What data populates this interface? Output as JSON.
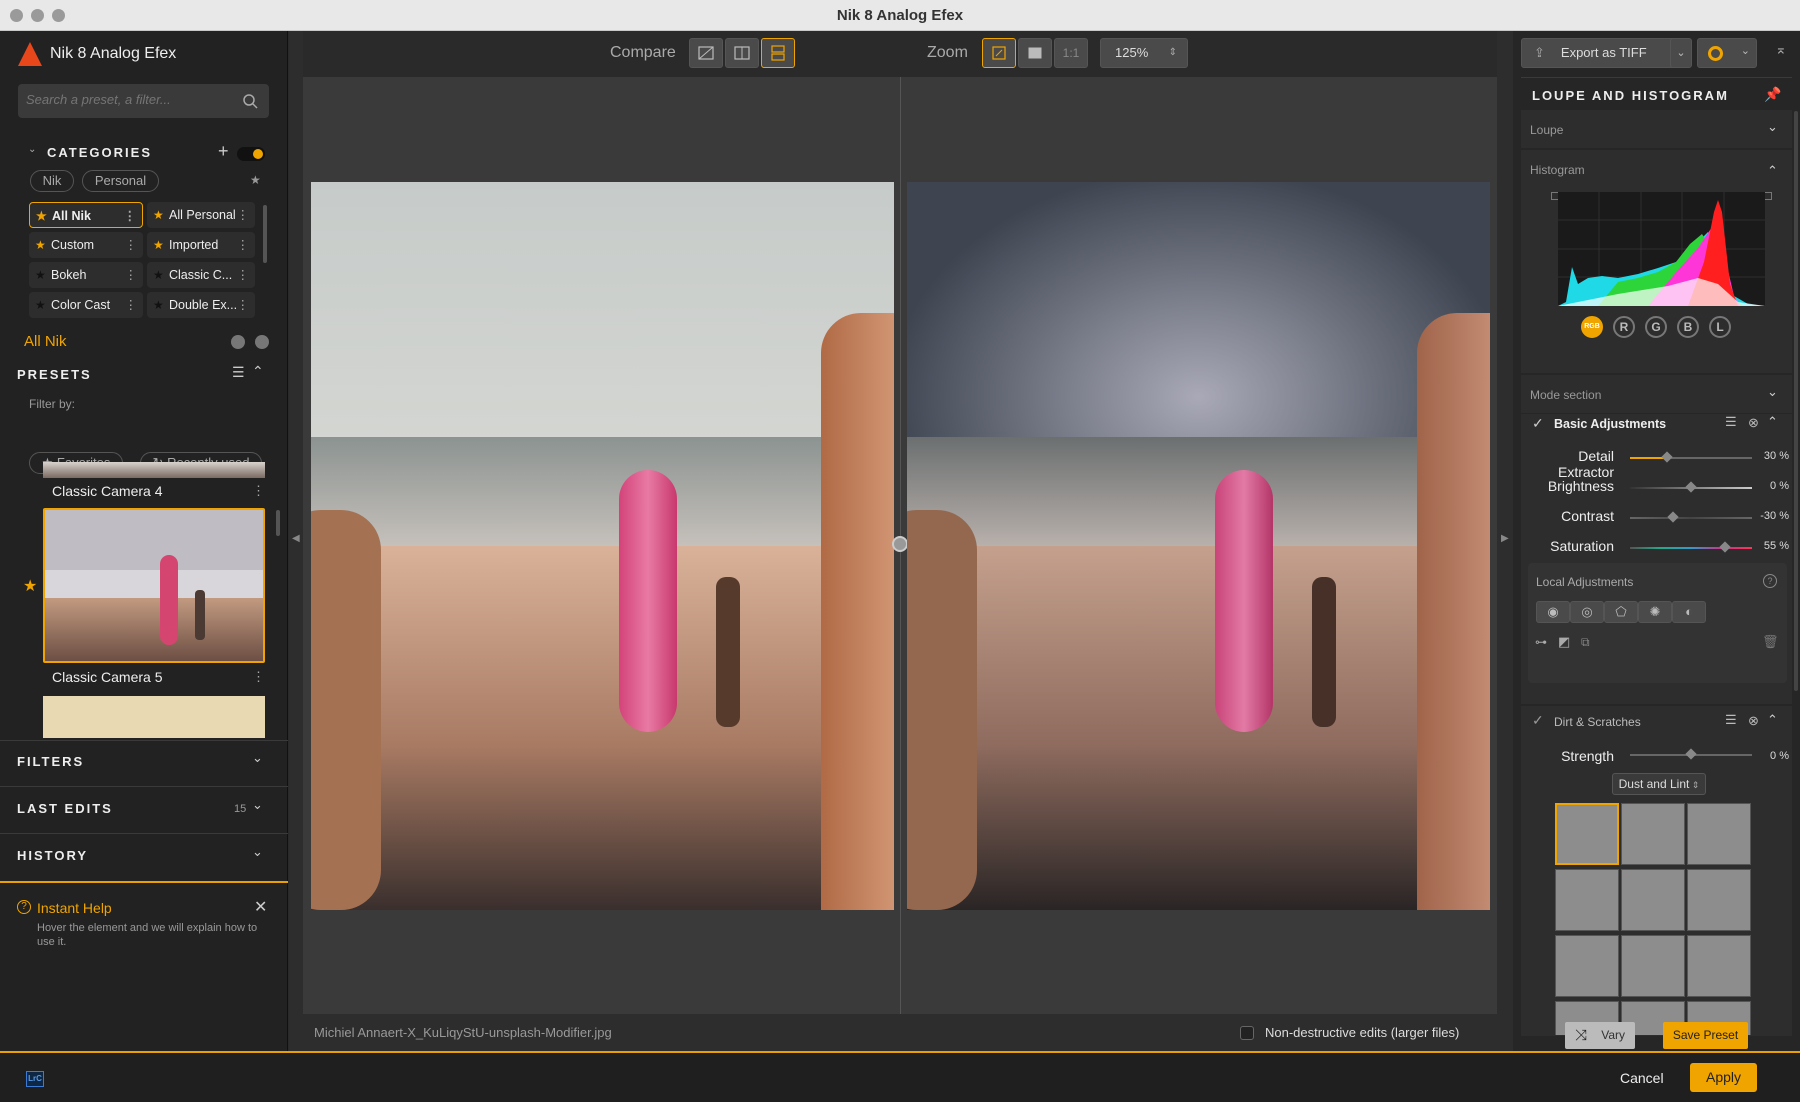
{
  "window": {
    "title": "Nik 8 Analog Efex"
  },
  "app": {
    "name": "Nik 8 Analog Efex"
  },
  "search": {
    "placeholder": "Search a preset, a filter..."
  },
  "categories": {
    "header": "CATEGORIES",
    "chips": [
      "Nik",
      "Personal"
    ],
    "items": [
      {
        "label": "All Nik",
        "selected": true
      },
      {
        "label": "All Personal"
      },
      {
        "label": "Custom"
      },
      {
        "label": "Imported"
      },
      {
        "label": "Bokeh"
      },
      {
        "label": "Classic C..."
      },
      {
        "label": "Color Cast"
      },
      {
        "label": "Double Ex..."
      }
    ],
    "current": "All Nik"
  },
  "presets": {
    "header": "PRESETS",
    "filter_by": "Filter by:",
    "favorites": "Favorites",
    "recently_used": "Recently used",
    "items": [
      {
        "label": "Classic Camera 4"
      },
      {
        "label": "Classic Camera 5",
        "selected": true,
        "favorite": true
      }
    ]
  },
  "sections": {
    "filters": "FILTERS",
    "last_edits": "LAST EDITS",
    "last_edits_count": "15",
    "history": "HISTORY"
  },
  "help": {
    "title": "Instant Help",
    "text": "Hover the element and we will explain how to use it."
  },
  "toolbar": {
    "compare_label": "Compare",
    "zoom_label": "Zoom",
    "one_to_one": "1:1",
    "zoom_value": "125%",
    "export_label": "Export as TIFF"
  },
  "status": {
    "filename": "Michiel Annaert-X_KuLiqyStU-unsplash-Modifier.jpg",
    "nondestructive": "Non-destructive edits (larger files)"
  },
  "right": {
    "loupe_hist_header": "LOUPE AND HISTOGRAM",
    "loupe": "Loupe",
    "histogram": "Histogram",
    "channels": [
      "RGB",
      "R",
      "G",
      "B",
      "L"
    ],
    "mode_section": "Mode section",
    "basic_title": "Basic Adjustments",
    "basic": [
      {
        "label": "Detail Extractor",
        "value": "30 %",
        "level": 0.3
      },
      {
        "label": "Brightness",
        "value": "0 %",
        "level": 0.5
      },
      {
        "label": "Contrast",
        "value": "-30 %",
        "level": 0.35
      },
      {
        "label": "Saturation",
        "value": "55 %",
        "level": 0.775
      }
    ],
    "local_adjustments": "Local Adjustments",
    "dirt_title": "Dirt & Scratches",
    "strength_label": "Strength",
    "strength_value": "0 %",
    "dirt_type": "Dust and Lint",
    "vary": "Vary",
    "save_preset": "Save Preset"
  },
  "footer": {
    "lrc": "LrC",
    "cancel": "Cancel",
    "apply": "Apply"
  },
  "colors": {
    "accent": "#f0a400",
    "panel": "#222222"
  }
}
